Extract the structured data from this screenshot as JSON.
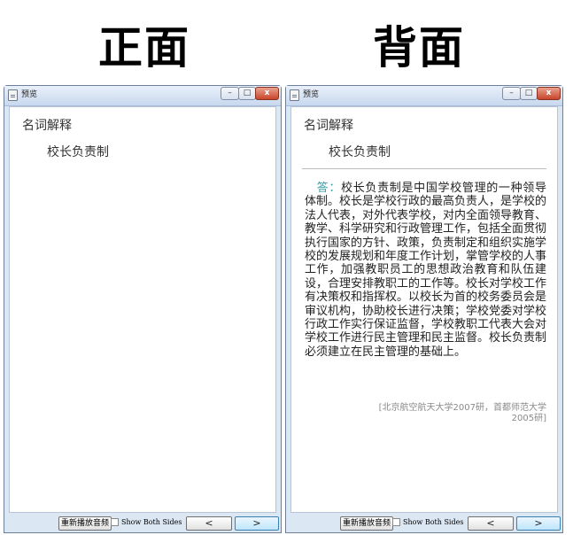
{
  "headings": {
    "front": "正面",
    "back": "背面"
  },
  "window": {
    "title": "预览"
  },
  "card": {
    "type": "名词解释",
    "question": "校长负责制",
    "answer_label": "答：",
    "answer_text": "校长负责制是中国学校管理的一种领导体制。校长是学校行政的最高负责人，是学校的法人代表，对外代表学校，对内全面领导教育、教学、科学研究和行政管理工作，包括全面贯彻执行国家的方针、政策，负责制定和组织实施学校的发展规划和年度工作计划，掌管学校的人事工作，加强教职员工的思想政治教育和队伍建设，合理安排教职工的工作等。校长对学校工作有决策权和指挥权。以校长为首的校务委员会是审议机构，协助校长进行决策；学校党委对学校行政工作实行保证监督，学校教职工代表大会对学校工作进行民主管理和民主监督。校长负责制必须建立在民主管理的基础上。",
    "source": "[北京航空航天大学2007研，首都师范大学2005研]"
  },
  "bottom_bar": {
    "replay_label": "重新播放音频",
    "show_both_label": "Show Both Sides",
    "prev_label": "<",
    "next_label": ">"
  },
  "window_controls": {
    "minimize": "–",
    "maximize": "□",
    "close": "x"
  }
}
